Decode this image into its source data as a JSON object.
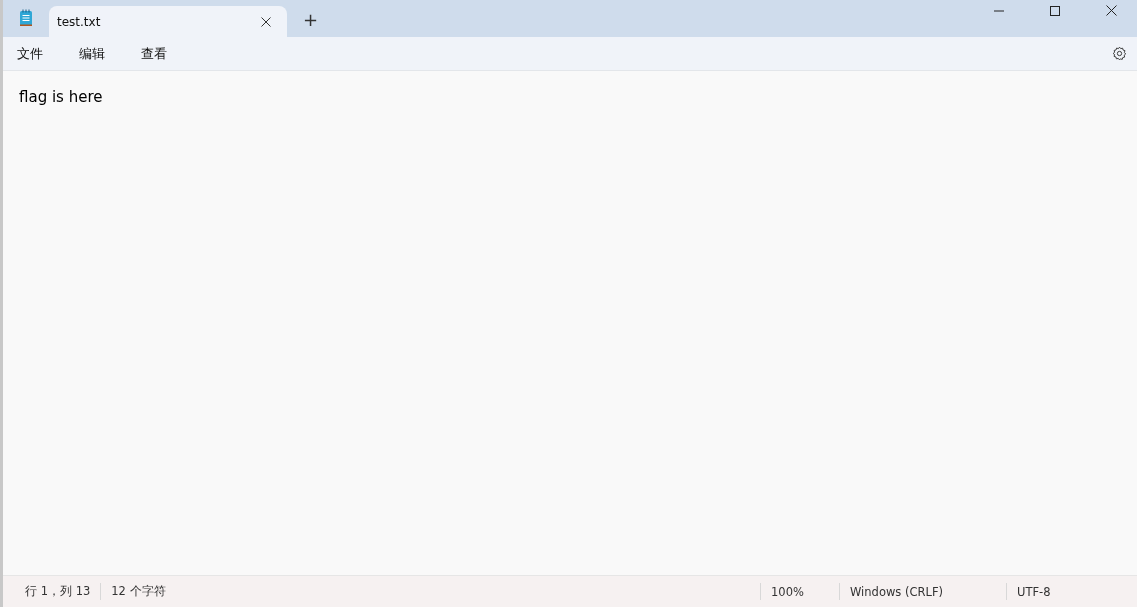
{
  "tabs": [
    {
      "label": "test.txt",
      "selected": true
    }
  ],
  "new_tab": "+",
  "menu": [
    "文件",
    "编辑",
    "查看"
  ],
  "editor": {
    "text": "flag is here"
  },
  "status_bar": {
    "position": "行 1，列 13",
    "characters": "12 个字符",
    "zoom": "100%",
    "line_ending": "Windows (CRLF)",
    "encoding": "UTF-8"
  }
}
